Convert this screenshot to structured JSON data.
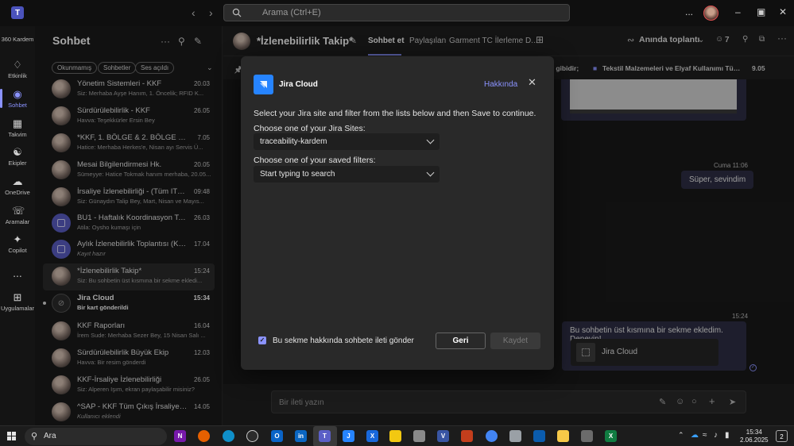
{
  "titlebar": {
    "search_placeholder": "Arama (Ctrl+E)",
    "more": "...",
    "minimize": "–",
    "restore": "▣",
    "close": "✕"
  },
  "rail": {
    "items": [
      {
        "label": "360 Kardem",
        "icon": "360-icon"
      },
      {
        "label": "Etkinlik",
        "icon": "bell-icon"
      },
      {
        "label": "Sohbet",
        "icon": "chat-icon"
      },
      {
        "label": "Takvim",
        "icon": "calendar-icon"
      },
      {
        "label": "Ekipler",
        "icon": "teams-icon"
      },
      {
        "label": "OneDrive",
        "icon": "cloud-icon"
      },
      {
        "label": "Aramalar",
        "icon": "phone-icon"
      },
      {
        "label": "Copilot",
        "icon": "copilot-icon"
      },
      {
        "label": "...",
        "icon": "more-icon"
      },
      {
        "label": "Uygulamalar",
        "icon": "plus-icon"
      }
    ]
  },
  "chatpanel": {
    "title": "Sohbet",
    "filters": [
      "Okunmamış",
      "Sohbetler",
      "Ses açıldı"
    ],
    "chats": [
      {
        "name": "Yönetim Sistemleri - KKF",
        "time": "20.03",
        "preview": "Siz: Merhaba Ayşe Hanım,   1. Öncelik; RFID K..."
      },
      {
        "name": "Sürdürülebilirlik - KKF",
        "time": "26.05",
        "preview": "Havva: Teşekkürler Ersin  Bey"
      },
      {
        "name": "*KKF, 1. BÖLGE & 2. BÖLGE KAYIP ...",
        "time": "7.05",
        "preview": "Hatice: Merhaba Herkes'e,   Nisan ayı Servis Ü..."
      },
      {
        "name": "Mesai Bilgilendirmesi Hk.",
        "time": "20.05",
        "preview": "Sümeyye: Hatice Tokmak hanım merhaba, 20.05..."
      },
      {
        "name": "İrsaliye İzlenebilirliği - (Tüm ITX, ...",
        "time": "09:48",
        "preview": "Siz: Günaydın Talip Bey,   Mart, Nisan ve Mayıs..."
      },
      {
        "name": "BU1 - Haftalık Koordinasyon Topl...",
        "time": "26.03",
        "preview": "Atila: Oysho kumaşı için"
      },
      {
        "name": "Aylık İzlenebilirlik Toplantısı (KKF-...",
        "time": "17.04",
        "preview": "Kayıt hazır"
      },
      {
        "name": "*İzlenebilirlik Takip*",
        "time": "15:24",
        "preview": "Siz: Bu sohbetin üst kısmına bir sekme ekledi..."
      },
      {
        "name": "Jira Cloud",
        "time": "15:34",
        "preview": "Bir kart gönderildi"
      },
      {
        "name": "KKF Raporları",
        "time": "16.04",
        "preview": "İrem Sude: Merhaba Sezer Bey, 15 Nisan Salı ..."
      },
      {
        "name": "Sürdürülebilirlik Büyük Ekip",
        "time": "12.03",
        "preview": "Havva: Bir resim gönderdi"
      },
      {
        "name": "KKF-İrsaliye İzlenebilirliği",
        "time": "26.05",
        "preview": "Siz: Alperen Işım, ekran paylaşabilir misiniz?"
      },
      {
        "name": "^SAP - KKF Tüm Çıkış İrsaliye Rez...",
        "time": "14.05",
        "preview": "Kullanıcı eklendi"
      }
    ]
  },
  "main": {
    "title": "*İzlenebilirlik Takip*",
    "tabs": [
      "Sohbet et",
      "Paylaşılan",
      "Garment TC İlerleme D..."
    ],
    "meet_label": "Anında toplantı",
    "participants": "7",
    "pinned_left": "daki gibidir;",
    "pinned_right": "Tekstil Malzemeleri ve Elyaf Kullanımı Tüm tekstil ...",
    "pinned_date": "9.05",
    "msg1_meta": "Cuma 11:06",
    "msg1_text": "Süper, sevindim",
    "msg2_meta": "15:24",
    "msg2_text": "Bu sohbetin üst kısmına bir sekme ekledim. Deneyin!",
    "card_title": "Jira Cloud",
    "composer_placeholder": "Bir ileti yazın"
  },
  "dialog": {
    "title": "Jira Cloud",
    "about": "Hakkında",
    "close": "✕",
    "intro": "Select your Jira site and filter from the lists below and then Save to continue.",
    "site_label": "Choose one of your Jira Sites:",
    "site_value": "traceability-kardem",
    "filter_label": "Choose one of your saved filters:",
    "filter_placeholder": "Start typing to search",
    "checkbox_label": "Bu sekme hakkında sohbete ileti gönder",
    "checkbox_checked": true,
    "back_label": "Geri",
    "save_label": "Kaydet"
  },
  "taskbar": {
    "search_label": "Ara",
    "time": "15:34",
    "date": "2.06.2025",
    "notifications": "2",
    "apps": [
      "onenote-icon",
      "firefox-icon",
      "edge-icon",
      "obs-icon",
      "outlook-icon",
      "linkedin-icon",
      "teams-icon",
      "jira-icon",
      "confluence-icon",
      "powerbi-icon",
      "app-icon",
      "visio-icon",
      "m365-icon",
      "chrome-icon",
      "app2-icon",
      "defender-icon",
      "explorer-icon",
      "calculator-icon",
      "excel-icon"
    ]
  },
  "colors": {
    "accent": "#8b93ff",
    "jira": "#2684ff",
    "bubble": "#2e2f45"
  }
}
